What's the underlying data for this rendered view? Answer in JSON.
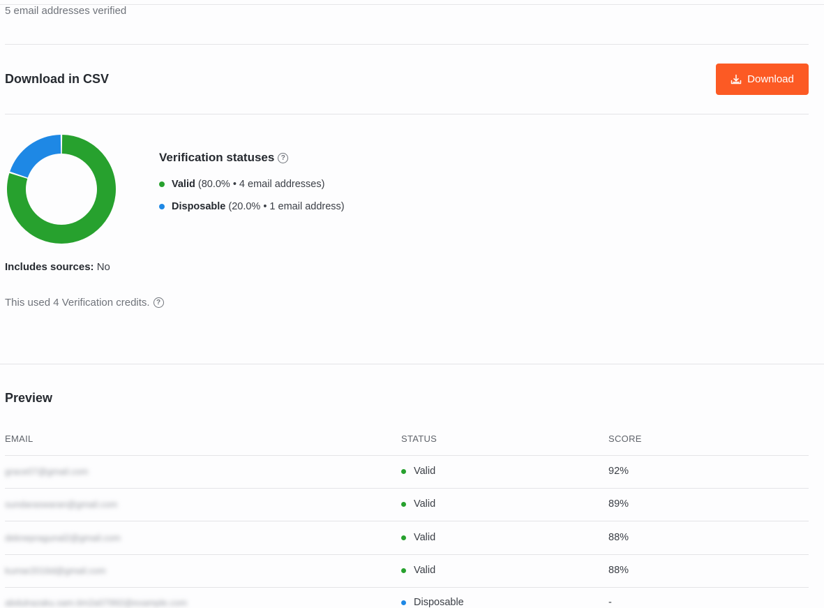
{
  "summary": {
    "verified_count_text": "5 email addresses verified"
  },
  "csv": {
    "title": "Download in CSV",
    "download_label": "Download"
  },
  "chart_data": {
    "type": "pie",
    "title": "Verification statuses",
    "series": [
      {
        "name": "Valid",
        "value": 80.0,
        "count_text": "(80.0% • 4 email addresses)",
        "color": "#27a12e"
      },
      {
        "name": "Disposable",
        "value": 20.0,
        "count_text": "(20.0% • 1 email address)",
        "color": "#1e88e5"
      }
    ]
  },
  "legend": {
    "title": "Verification statuses",
    "help_glyph": "?",
    "items": [
      {
        "label": "Valid",
        "detail": "(80.0% • 4 email addresses)",
        "color": "#27a12e"
      },
      {
        "label": "Disposable",
        "detail": "(20.0% • 1 email address)",
        "color": "#1e88e5"
      }
    ]
  },
  "sources": {
    "label": "Includes sources:",
    "value": "No"
  },
  "credits": {
    "text": "This used 4 Verification credits.",
    "help_glyph": "?"
  },
  "preview": {
    "title": "Preview",
    "columns": {
      "email": "EMAIL",
      "status": "STATUS",
      "score": "SCORE"
    },
    "rows": [
      {
        "email": "grace07@gmail.com",
        "status": "Valid",
        "score": "92%",
        "color": "#27a12e"
      },
      {
        "email": "sundaraswaran@gmail.com",
        "status": "Valid",
        "score": "89%",
        "color": "#27a12e"
      },
      {
        "email": "deknepragunal2@gmail.com",
        "status": "Valid",
        "score": "88%",
        "color": "#27a12e"
      },
      {
        "email": "kumar2016d@gmail.com",
        "status": "Valid",
        "score": "88%",
        "color": "#27a12e"
      },
      {
        "email": "abdulrazaku.sam.tim2a07992@example.com",
        "status": "Disposable",
        "score": "-",
        "color": "#1e88e5"
      }
    ]
  },
  "colors": {
    "accent": "#fc5a24",
    "valid": "#27a12e",
    "disposable": "#1e88e5"
  }
}
